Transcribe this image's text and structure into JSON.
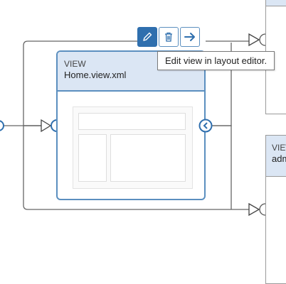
{
  "home_view": {
    "kind": "VIEW",
    "file": "Home.view.xml"
  },
  "admin_view": {
    "kind": "VIEW",
    "file": "admin"
  },
  "toolbar": {
    "edit": "pencil-icon",
    "delete": "trash-icon",
    "navigate": "arrow-right-icon"
  },
  "tooltip": {
    "text": "Edit view in layout editor."
  },
  "colors": {
    "accent": "#2f6fae",
    "node_border": "#5b8fbf",
    "header_fill": "#dbe6f4",
    "wire": "#666666"
  }
}
